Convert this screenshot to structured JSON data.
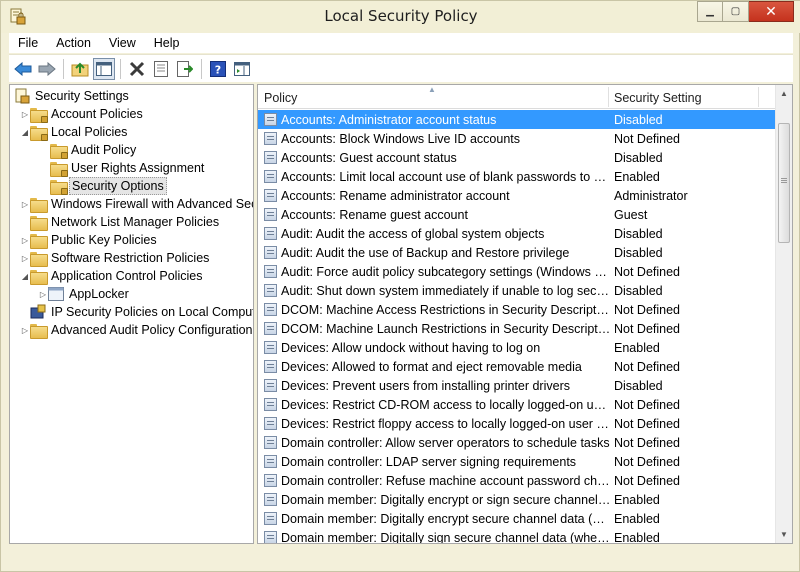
{
  "window": {
    "title": "Local Security Policy",
    "minimize_glyph": "▁",
    "maximize_glyph": "▢",
    "close_glyph": "✕"
  },
  "menu": {
    "items": [
      {
        "label": "File"
      },
      {
        "label": "Action"
      },
      {
        "label": "View"
      },
      {
        "label": "Help"
      }
    ]
  },
  "toolbar": {
    "icons": [
      "back-icon",
      "forward-icon",
      "up-folder-icon",
      "show-hide-tree-icon",
      "delete-icon",
      "properties-icon",
      "export-list-icon",
      "help-icon",
      "show-action-pane-icon"
    ]
  },
  "tree": {
    "root": "Security Settings",
    "items": [
      {
        "label": "Account Policies",
        "expander": "▷"
      },
      {
        "label": "Local Policies",
        "expander": "◢"
      },
      {
        "label": "Audit Policy"
      },
      {
        "label": "User Rights Assignment"
      },
      {
        "label": "Security Options"
      },
      {
        "label": "Windows Firewall with Advanced Secu",
        "expander": "▷"
      },
      {
        "label": "Network List Manager Policies"
      },
      {
        "label": "Public Key Policies",
        "expander": "▷"
      },
      {
        "label": "Software Restriction Policies",
        "expander": "▷"
      },
      {
        "label": "Application Control Policies",
        "expander": "◢"
      },
      {
        "label": "AppLocker",
        "expander": "▷"
      },
      {
        "label": "IP Security Policies on Local Compute"
      },
      {
        "label": "Advanced Audit Policy Configuration",
        "expander": "▷"
      }
    ]
  },
  "table": {
    "columns": {
      "policy": "Policy",
      "setting": "Security Setting"
    },
    "sort_glyph": "▲",
    "rows": [
      {
        "policy": "Accounts: Administrator account status",
        "setting": "Disabled"
      },
      {
        "policy": "Accounts: Block Windows Live ID accounts",
        "setting": "Not Defined"
      },
      {
        "policy": "Accounts: Guest account status",
        "setting": "Disabled"
      },
      {
        "policy": "Accounts: Limit local account use of blank passwords to co...",
        "setting": "Enabled"
      },
      {
        "policy": "Accounts: Rename administrator account",
        "setting": "Administrator"
      },
      {
        "policy": "Accounts: Rename guest account",
        "setting": "Guest"
      },
      {
        "policy": "Audit: Audit the access of global system objects",
        "setting": "Disabled"
      },
      {
        "policy": "Audit: Audit the use of Backup and Restore privilege",
        "setting": "Disabled"
      },
      {
        "policy": "Audit: Force audit policy subcategory settings (Windows Vis...",
        "setting": "Not Defined"
      },
      {
        "policy": "Audit: Shut down system immediately if unable to log secur...",
        "setting": "Disabled"
      },
      {
        "policy": "DCOM: Machine Access Restrictions in Security Descriptor D...",
        "setting": "Not Defined"
      },
      {
        "policy": "DCOM: Machine Launch Restrictions in Security Descriptor ...",
        "setting": "Not Defined"
      },
      {
        "policy": "Devices: Allow undock without having to log on",
        "setting": "Enabled"
      },
      {
        "policy": "Devices: Allowed to format and eject removable media",
        "setting": "Not Defined"
      },
      {
        "policy": "Devices: Prevent users from installing printer drivers",
        "setting": "Disabled"
      },
      {
        "policy": "Devices: Restrict CD-ROM access to locally logged-on user ...",
        "setting": "Not Defined"
      },
      {
        "policy": "Devices: Restrict floppy access to locally logged-on user only",
        "setting": "Not Defined"
      },
      {
        "policy": "Domain controller: Allow server operators to schedule tasks",
        "setting": "Not Defined"
      },
      {
        "policy": "Domain controller: LDAP server signing requirements",
        "setting": "Not Defined"
      },
      {
        "policy": "Domain controller: Refuse machine account password chan...",
        "setting": "Not Defined"
      },
      {
        "policy": "Domain member: Digitally encrypt or sign secure channel d...",
        "setting": "Enabled"
      },
      {
        "policy": "Domain member: Digitally encrypt secure channel data (wh...",
        "setting": "Enabled"
      },
      {
        "policy": "Domain member: Digitally sign secure channel data (when ...",
        "setting": "Enabled"
      }
    ]
  },
  "scrollbar": {
    "up_glyph": "▲",
    "down_glyph": "▼"
  },
  "colors": {
    "selection": "#3399ff",
    "frame": "#f3f0da"
  }
}
